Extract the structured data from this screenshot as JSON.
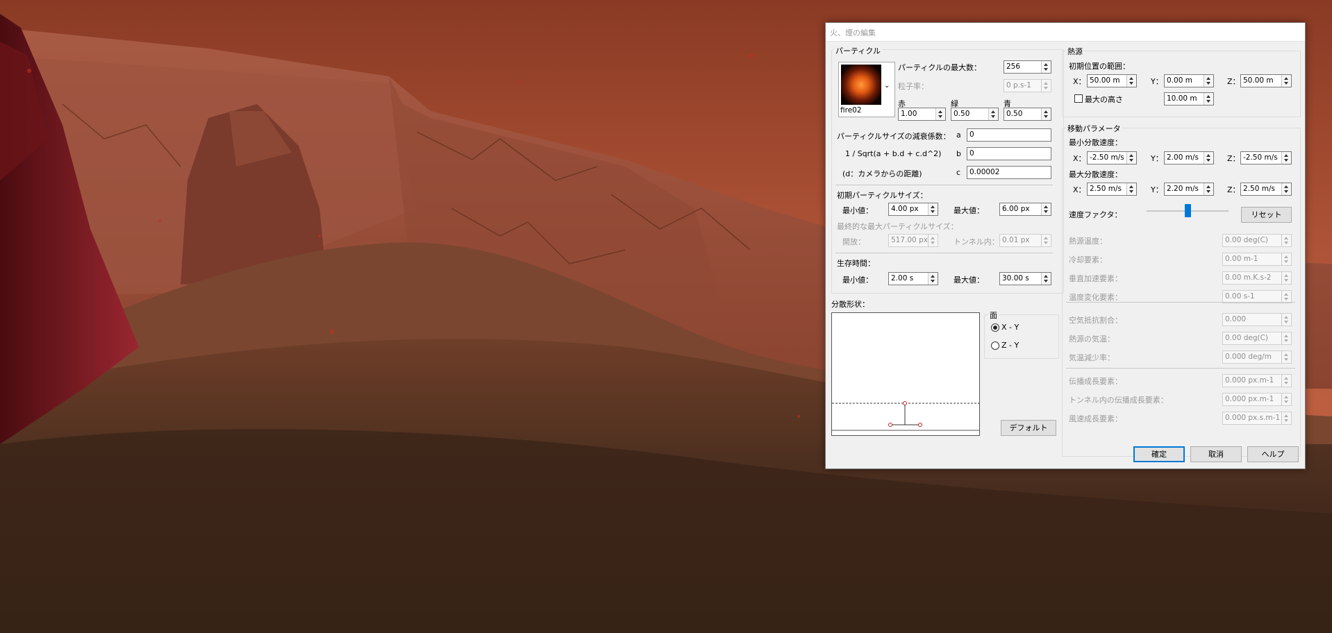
{
  "window": {
    "title": "火、煙の編集"
  },
  "particle": {
    "group_title": "パーティクル",
    "texture_name": "fire02",
    "max_count_label": "パーティクルの最大数：",
    "max_count_value": "256",
    "rate_label": "粒子率：",
    "rate_value": "0 p.s-1",
    "red_label": "赤",
    "red_value": "1.00",
    "green_label": "緑",
    "green_value": "0.50",
    "blue_label": "青",
    "blue_value": "0.50",
    "attenuation_label": "パーティクルサイズの減衰係数：",
    "formula_label": "1 / Sqrt(a + b.d + c.d^2)",
    "distance_label": "(d：カメラからの距離)",
    "coef_a_label": "a",
    "coef_a_value": "0",
    "coef_b_label": "b",
    "coef_b_value": "0",
    "coef_c_label": "c",
    "coef_c_value": "0.00002",
    "init_size_label": "初期パーティクルサイズ：",
    "min_label": "最小値：",
    "min_size_value": "4.00 px",
    "max_label": "最大値：",
    "max_size_value": "6.00 px",
    "final_size_label": "最終的な最大パーティクルサイズ：",
    "open_label": "開放：",
    "open_value": "517.00 px",
    "tunnel_label": "トンネル内：",
    "tunnel_value": "0.01 px",
    "lifetime_label": "生存時間：",
    "life_min_value": "2.00 s",
    "life_max_value": "30.00 s"
  },
  "distribution": {
    "title": "分散形状：",
    "plane_title": "面",
    "plane_xy": "X - Y",
    "plane_zy": "Z - Y",
    "default_button": "デフォルト"
  },
  "heat_source": {
    "group_title": "熱源",
    "range_label": "初期位置の範囲：",
    "x_label": "X：",
    "x_value": "50.00 m",
    "y_label": "Y：",
    "y_value": "0.00 m",
    "z_label": "Z：",
    "z_value": "50.00 m",
    "max_height_label": "最大の高さ",
    "max_height_value": "10.00 m"
  },
  "motion": {
    "group_title": "移動パラメータ",
    "min_speed_label": "最小分散速度：",
    "min_x_label": "X：",
    "min_x_value": "-2.50 m/s",
    "min_y_label": "Y：",
    "min_y_value": "2.00 m/s",
    "min_z_label": "Z：",
    "min_z_value": "-2.50 m/s",
    "max_speed_label": "最大分散速度：",
    "max_x_label": "X：",
    "max_x_value": "2.50 m/s",
    "max_y_label": "Y：",
    "max_y_value": "2.20 m/s",
    "max_z_label": "Z：",
    "max_z_value": "2.50 m/s",
    "speed_factor_label": "速度ファクタ：",
    "speed_factor_level": 0.5,
    "reset_button": "リセット",
    "params": [
      {
        "label": "熱源温度：",
        "value": "0.00 deg(C)"
      },
      {
        "label": "冷却要素：",
        "value": "0.00 m-1"
      },
      {
        "label": "垂直加速要素：",
        "value": "0.00 m.K.s-2"
      },
      {
        "label": "温度変化要素：",
        "value": "0.00 s-1"
      },
      {
        "label": "空気抵抗割合：",
        "value": "0.000"
      },
      {
        "label": "熱源の気温：",
        "value": "0.00 deg(C)"
      },
      {
        "label": "気温減少率：",
        "value": "0.000 deg/m"
      },
      {
        "label": "伝播成長要素：",
        "value": "0.000 px.m-1"
      },
      {
        "label": "トンネル内の伝播成長要素：",
        "value": "0.000 px.m-1"
      },
      {
        "label": "風速成長要素：",
        "value": "0.000 px.s.m-1"
      }
    ]
  },
  "footer": {
    "ok_button": "確定",
    "cancel_button": "取消",
    "help_button": "ヘルプ"
  }
}
